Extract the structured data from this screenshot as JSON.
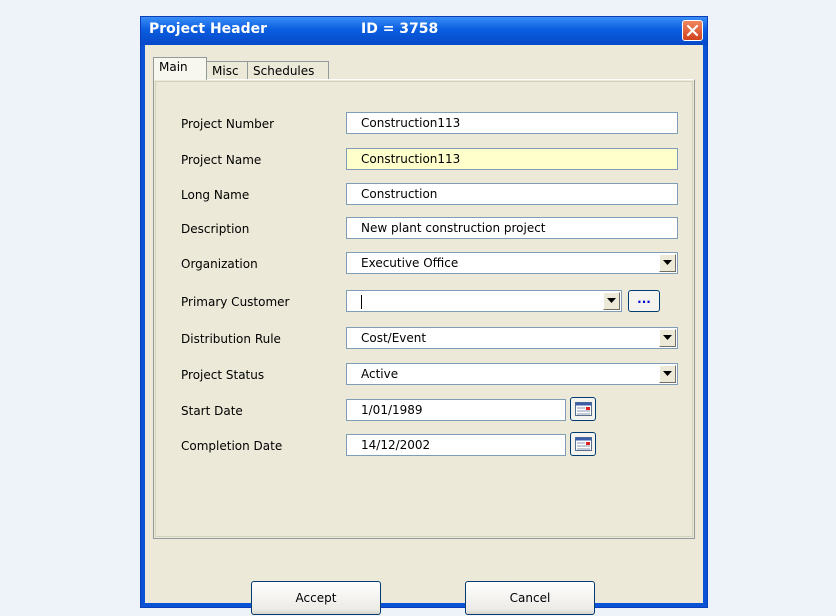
{
  "window": {
    "title": "Project Header",
    "id_label": "ID = 3758"
  },
  "tabs": [
    {
      "label": "Main"
    },
    {
      "label": "Misc"
    },
    {
      "label": "Schedules"
    }
  ],
  "form": {
    "project_number": {
      "label": "Project Number",
      "value": "Construction113"
    },
    "project_name": {
      "label": "Project Name",
      "value": "Construction113"
    },
    "long_name": {
      "label": "Long Name",
      "value": "Construction"
    },
    "description": {
      "label": "Description",
      "value": "New plant construction project"
    },
    "organization": {
      "label": "Organization",
      "value": "Executive Office"
    },
    "primary_customer": {
      "label": "Primary Customer",
      "value": "",
      "lookup_label": "..."
    },
    "distribution_rule": {
      "label": "Distribution Rule",
      "value": "Cost/Event"
    },
    "project_status": {
      "label": "Project Status",
      "value": "Active"
    },
    "start_date": {
      "label": "Start Date",
      "value": "1/01/1989"
    },
    "completion_date": {
      "label": "Completion Date",
      "value": "14/12/2002"
    }
  },
  "buttons": {
    "accept": "Accept",
    "cancel": "Cancel"
  },
  "colors": {
    "titlebar": "#0a5ee0",
    "highlight_field": "#ffffcc",
    "dialog_bg": "#ece9d8"
  }
}
